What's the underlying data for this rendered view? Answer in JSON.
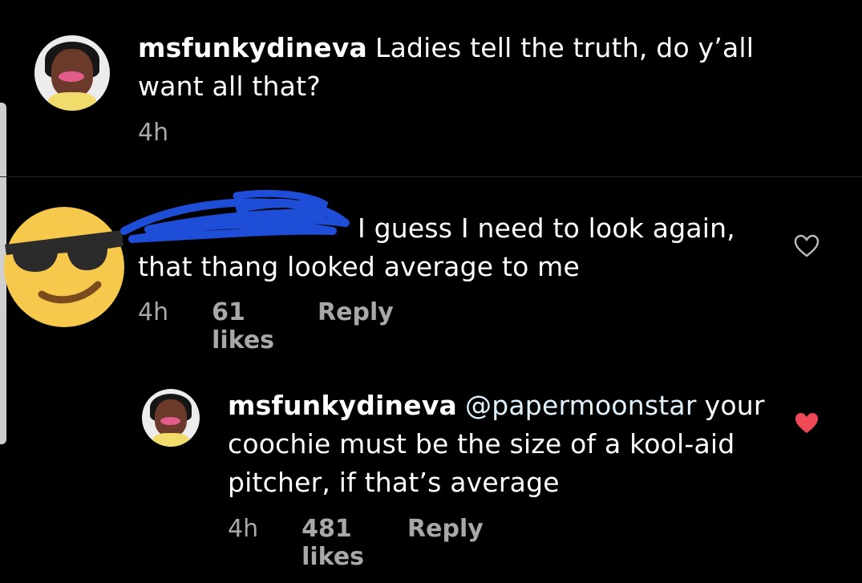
{
  "comments": [
    {
      "username": "msfunkydineva",
      "text": "Ladies tell the truth, do y’all want all that?",
      "time": "4h"
    },
    {
      "username": "",
      "text": "I guess I need to look again, that thang looked average to me",
      "time": "4h",
      "likes": "61 likes",
      "reply_label": "Reply",
      "heart_icon": "heart-outline-icon"
    },
    {
      "username": "msfunkydineva",
      "mention": "@papermoonstar",
      "text": "your coochie must be the size of a kool-aid pitcher, if that’s average",
      "time": "4h",
      "likes": "481 likes",
      "reply_label": "Reply",
      "heart_icon": "heart-filled-icon",
      "liked_color": "#ed4956"
    }
  ],
  "colors": {
    "background": "#000000",
    "secondary_text": "#a8a8a8",
    "mention": "#e0f1ff",
    "scribble": "#1e4dd8",
    "emoji": "#f6c84b"
  }
}
